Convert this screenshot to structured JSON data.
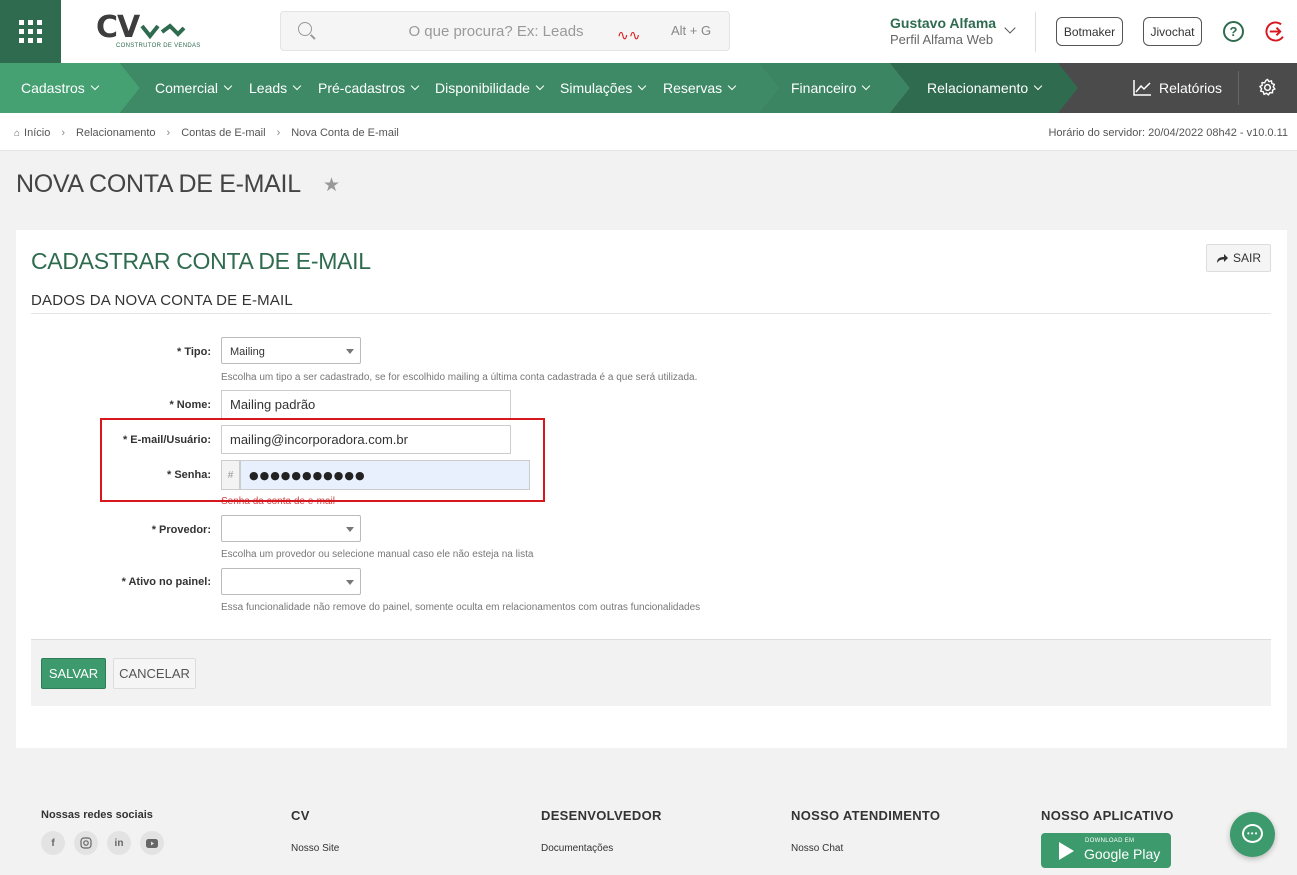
{
  "header": {
    "search_placeholder": "O que procura? Ex: Leads",
    "search_shortcut": "Alt + G",
    "logo_text": "CV",
    "logo_subtitle": "CONSTRUTOR DE VENDAS",
    "user_name": "Gustavo Alfama",
    "user_profile": "Perfil Alfama Web",
    "btn_botmaker": "Botmaker",
    "btn_jivochat": "Jivochat",
    "help": "?"
  },
  "nav": {
    "items": [
      "Cadastros",
      "Comercial",
      "Leads",
      "Pré-cadastros",
      "Disponibilidade",
      "Simulações",
      "Reservas",
      "Financeiro",
      "Relacionamento"
    ],
    "reports": "Relatórios"
  },
  "breadcrumb": {
    "items": [
      "Início",
      "Relacionamento",
      "Contas de E-mail",
      "Nova Conta de E-mail"
    ],
    "server_time": "Horário do servidor: 20/04/2022 08h42 - v10.0.11"
  },
  "page": {
    "title": "NOVA CONTA DE E-MAIL",
    "panel_title": "CADASTRAR CONTA DE E-MAIL",
    "exit_label": "SAIR",
    "section_title": "DADOS DA NOVA CONTA DE E-MAIL"
  },
  "form": {
    "tipo": {
      "label": "* Tipo:",
      "value": "Mailing",
      "hint": "Escolha um tipo a ser cadastrado, se for escolhido mailing a última conta cadastrada é a que será utilizada."
    },
    "nome": {
      "label": "* Nome:",
      "value": "Mailing padrão"
    },
    "email": {
      "label": "* E-mail/Usuário:",
      "value": "mailing@incorporadora.com.br"
    },
    "senha": {
      "label": "* Senha:",
      "addon": "#",
      "value": "●●●●●●●●●●●",
      "hint": "Senha da conta de e-mail"
    },
    "provedor": {
      "label": "* Provedor:",
      "value": "",
      "hint": "Escolha um provedor ou selecione manual caso ele não esteja na lista"
    },
    "ativo": {
      "label": "* Ativo no painel:",
      "value": "",
      "hint": "Essa funcionalidade não remove do painel, somente oculta em relacionamentos com outras funcionalidades"
    },
    "save": "SALVAR",
    "cancel": "CANCELAR"
  },
  "footer": {
    "social_title": "Nossas redes sociais",
    "social_icons": [
      "facebook-icon",
      "instagram-icon",
      "linkedin-icon",
      "youtube-icon"
    ],
    "cols": [
      {
        "title": "CV",
        "link": "Nosso Site"
      },
      {
        "title": "DESENVOLVEDOR",
        "link": "Documentações"
      },
      {
        "title": "NOSSO ATENDIMENTO",
        "link": "Nosso Chat"
      },
      {
        "title": "NOSSO APLICATIVO",
        "link": ""
      }
    ],
    "gplay_small": "DOWNLOAD EM",
    "gplay_big": "Google Play"
  },
  "colors": {
    "brand_green": "#2f6b4f",
    "nav_green": "#3e8a66",
    "button_green": "#3c9a6c",
    "highlight_red": "#d7171d"
  }
}
